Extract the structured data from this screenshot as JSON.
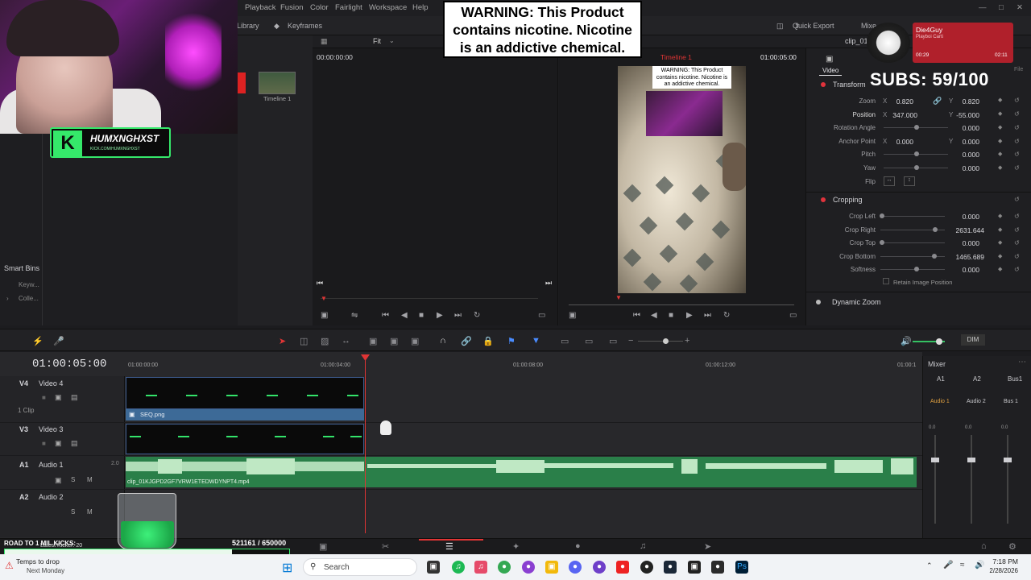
{
  "menu": {
    "items": [
      "Playback",
      "Fusion",
      "Color",
      "Fairlight",
      "Workspace",
      "Help"
    ]
  },
  "toolbar": {
    "library": "Library",
    "keyframes": "Keyframes",
    "fit": "Fit",
    "quick_export": "Quick Export",
    "mixer": "Mixe",
    "clip_name": "clip_01"
  },
  "media_pool": {
    "timeline_thumb_label": "Timeline 1",
    "smart_bins": "Smart Bins",
    "bin_items": [
      "Keyw...",
      "Colle..."
    ]
  },
  "source_viewer": {
    "timecode": "00:00:00:00"
  },
  "program_viewer": {
    "timeline_name": "Timeline 1",
    "timecode": "01:00:05:00",
    "warning_text": "WARNING: This Product contains nicotine. Nicotine is an addictive chemical."
  },
  "warning_banner": {
    "line1": "WARNING: This Product",
    "line2": "contains nicotine. Nicotine",
    "line3": "is an addictive chemical."
  },
  "inspector": {
    "tab": "Video",
    "transform": {
      "title": "Transform",
      "zoom_label": "Zoom",
      "zoom_x": "0.820",
      "zoom_y": "0.820",
      "position_label": "Position",
      "position_x": "347.000",
      "position_y": "-55.000",
      "rotation_label": "Rotation Angle",
      "rotation": "0.000",
      "anchor_label": "Anchor Point",
      "anchor_x": "0.000",
      "anchor_y": "0.000",
      "pitch_label": "Pitch",
      "pitch": "0.000",
      "yaw_label": "Yaw",
      "yaw": "0.000",
      "flip_label": "Flip"
    },
    "cropping": {
      "title": "Cropping",
      "left_label": "Crop Left",
      "left": "0.000",
      "right_label": "Crop Right",
      "right": "2631.644",
      "top_label": "Crop Top",
      "top": "0.000",
      "bottom_label": "Crop Bottom",
      "bottom": "1465.689",
      "softness_label": "Softness",
      "softness": "0.000",
      "retain_label": "Retain Image Position"
    },
    "dynamic_zoom": "Dynamic Zoom",
    "file_label": "File"
  },
  "stream_overlay": {
    "subs": "SUBS: 59/100",
    "music_artist": "Die4Guy",
    "music_sub": "Playboi Carti",
    "music_elapsed": "00:29",
    "music_total": "02:11",
    "kick_name": "HUMXNGHXST",
    "kick_url": "KICK.COM/HUMXNGHXST",
    "goal_label": "ROAD TO 1 MIL KICKS:",
    "goal_current": "521161",
    "goal_target": "/ 650000",
    "goal_fraction": 0.8,
    "goal_ticker": "Latest Kicker: 20"
  },
  "timeline": {
    "timecode": "01:00:05:00",
    "ruler": [
      "01:00:00:00",
      "01:00:04:00",
      "01:00:08:00",
      "01:00:12:00",
      "01:00:1"
    ],
    "tracks": {
      "v4": {
        "id": "V4",
        "name": "Video 4",
        "clips": "1 Clip"
      },
      "v3": {
        "id": "V3",
        "name": "Video 3"
      },
      "a1": {
        "id": "A1",
        "name": "Audio 1",
        "level": "2.0"
      },
      "a2": {
        "id": "A2",
        "name": "Audio 2"
      }
    },
    "video_clip": "SEQ.png",
    "audio_clip": "clip_01KJGPD2GF7VRW1ETEDWDYNPT4.mp4",
    "dim": "DIM"
  },
  "mixer": {
    "title": "Mixer",
    "channels": [
      "A1",
      "A2",
      "Bus1"
    ],
    "channel_names": [
      "Audio 1",
      "Audio 2",
      "Bus 1"
    ],
    "db_label": "0.0"
  },
  "taskbar": {
    "weather_title": "Temps to drop",
    "weather_sub": "Next Monday",
    "search": "Search",
    "time": "7:18 PM",
    "date": "2/28/2026"
  },
  "colors": {
    "accent_red": "#e03535",
    "kick_green": "#35e86a",
    "clip_blue": "#3d6a97",
    "audio_green": "#2a7f49"
  }
}
